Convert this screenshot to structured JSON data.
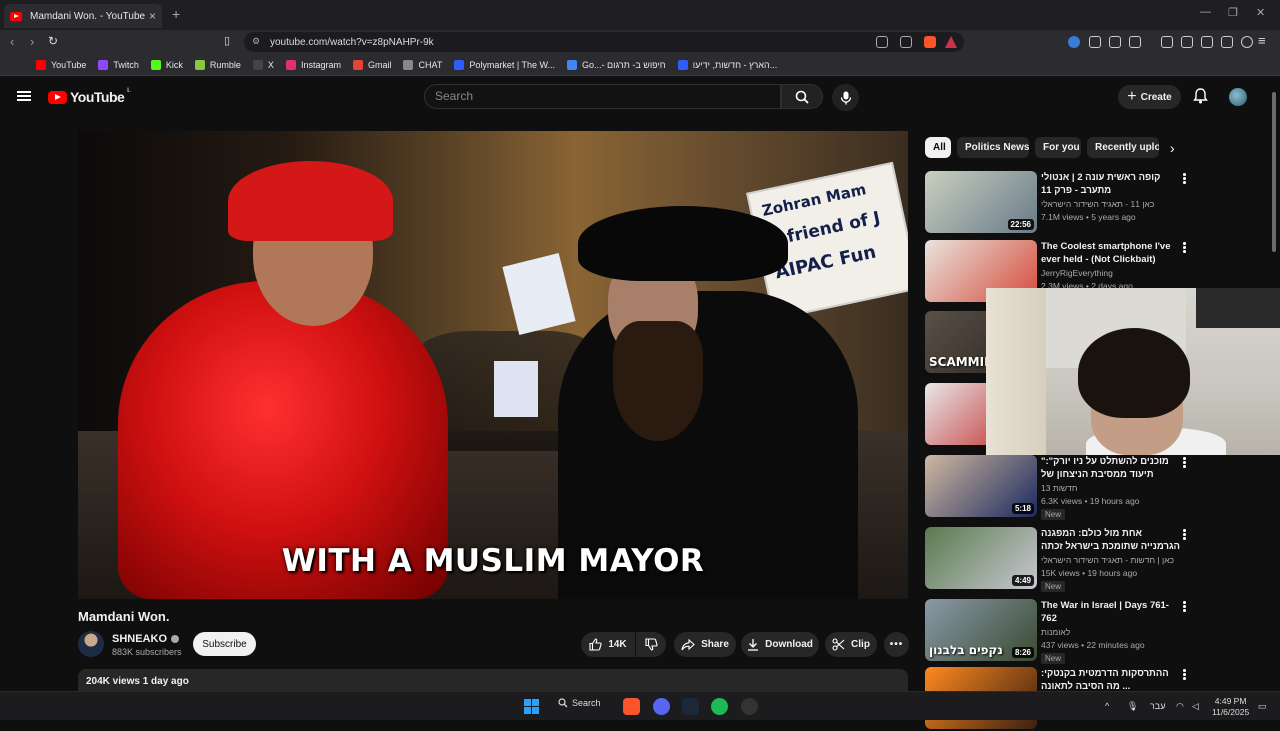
{
  "browser": {
    "tab_title": "Mamdani Won. - YouTube",
    "tab_close": "×",
    "new_tab": "+",
    "url": "youtube.com/watch?v=z8pNAHPr-9k",
    "bookmarks": [
      {
        "label": "YouTube",
        "color": "#ff0000"
      },
      {
        "label": "Twitch",
        "color": "#9146ff"
      },
      {
        "label": "Kick",
        "color": "#53fc18"
      },
      {
        "label": "Rumble",
        "color": "#85c742"
      },
      {
        "label": "X",
        "color": "#444444"
      },
      {
        "label": "Instagram",
        "color": "#e1306c"
      },
      {
        "label": "Gmail",
        "color": "#ea4335"
      },
      {
        "label": "CHAT",
        "color": "#888888"
      },
      {
        "label": "Polymarket | The W...",
        "color": "#2e5cff"
      },
      {
        "label": "Go...- חיפוש ב- תרגום",
        "color": "#4285f4"
      },
      {
        "label": "הארץ - חדשות, ידיעו...",
        "color": "#2e5cff"
      }
    ]
  },
  "youtube": {
    "logo_text": "YouTube",
    "country_code": "IL",
    "search_placeholder": "Search",
    "create_label": "Create"
  },
  "video": {
    "caption": "WITH A MUSLIM MAYOR",
    "sign_text": [
      "Zohran Mam",
      "A friend of J",
      "AIPAC Fun"
    ],
    "title": "Mamdani Won.",
    "channel": "SHNEAKO",
    "subscribers": "883K subscribers",
    "subscribe_label": "Subscribe",
    "likes": "14K",
    "share_label": "Share",
    "download_label": "Download",
    "clip_label": "Clip",
    "views_date": "204K views  1 day ago"
  },
  "chips": [
    "All",
    "Politics News",
    "For you",
    "Recently uploa"
  ],
  "recommendations": [
    {
      "title": "קופה ראשית עונה 2 | אנטולי מתערב - פרק 11",
      "channel": "כאן 11 - תאגיד השידור הישראלי",
      "meta": "7.1M views • 5 years ago",
      "duration": "22:56",
      "new": "",
      "thumb": [
        "#c8d0c0",
        "#6a7a88"
      ]
    },
    {
      "title": "The Coolest smartphone I've ever held - (Not Clickbait)",
      "channel": "JerryRigEverything",
      "meta": "2.3M views • 2 days ago",
      "duration": "",
      "new": "",
      "thumb": [
        "#e8e4de",
        "#d64a3a"
      ]
    },
    {
      "title": "",
      "channel": "",
      "meta": "",
      "duration": "",
      "new": "",
      "thumb": [
        "#5a5048",
        "#2a2520"
      ],
      "overlay_text": "SCAMMIN"
    },
    {
      "title": "",
      "channel": "",
      "meta": "",
      "duration": "",
      "new": "",
      "thumb": [
        "#e8e8e8",
        "#c02020"
      ]
    },
    {
      "title": "\"מוכנים להשתלט על ניו יורק\": תיעוד ממסיבת הניצחון של ממדאני",
      "channel": "13 חדשות",
      "meta": "6.3K views • 19 hours ago",
      "duration": "5:18",
      "new": "New",
      "thumb": [
        "#d0b8a0",
        "#1a2a60"
      ]
    },
    {
      "title": "אחת מול כולם: המפגנה הגרמנייה שתומכת בישראל זכתה ברסק ...",
      "channel": "כאן | חדשות - תאגיד השידור הישראלי",
      "meta": "15K views • 19 hours ago",
      "duration": "4:49",
      "new": "New",
      "thumb": [
        "#5a7a50",
        "#c8c8d0"
      ]
    },
    {
      "title": "The War in Israel | Days 761-762",
      "channel": "לאומנות",
      "meta": "437 views • 22 minutes ago",
      "duration": "8:26",
      "new": "New",
      "thumb": [
        "#8a9aa8",
        "#3a4a30"
      ],
      "overlay_text": "נקפים בלבנון"
    },
    {
      "title": "ההתרסקות הדרמטית בקנטקי: מה הסיבה לתאונה ... ",
      "channel": "",
      "meta": "",
      "duration": "",
      "new": "",
      "thumb": [
        "#ff8a20",
        "#3a2010"
      ]
    }
  ],
  "taskbar": {
    "search_label": "Search",
    "lang": "עבר",
    "time": "4:49 PM",
    "date": "11/6/2025"
  },
  "icons": {
    "search": "search-icon",
    "mic": "mic-icon",
    "bell": "notifications-icon",
    "like": "thumbs-up-icon",
    "dislike": "thumbs-down-icon",
    "share": "share-icon",
    "download": "download-icon",
    "clip": "scissors-icon",
    "more": "more-icon"
  }
}
